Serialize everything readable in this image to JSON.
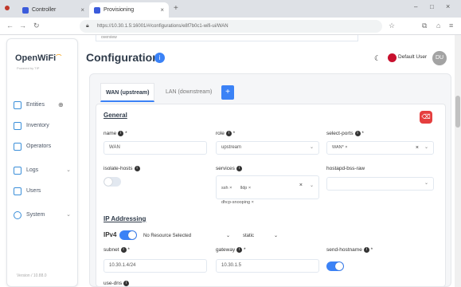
{
  "browser": {
    "tabs": [
      {
        "label": "Controller"
      },
      {
        "label": "Provisioning"
      }
    ],
    "url": "https://10.30.1.5:16001/#/configurations/e8f7b0c1-wifi-ui/WAN",
    "partial_top_text": "overview"
  },
  "sidebar": {
    "logo": "OpenWiFi",
    "logo_sub": "Powered by TIP",
    "items": [
      {
        "label": "Entities",
        "icon": "entities-icon",
        "has_chevron": false
      },
      {
        "label": "Inventory",
        "icon": "inventory-icon",
        "has_chevron": false
      },
      {
        "label": "Operators",
        "icon": "operators-icon",
        "has_chevron": false
      },
      {
        "label": "Logs",
        "icon": "logs-icon",
        "has_chevron": true
      },
      {
        "label": "Users",
        "icon": "users-icon",
        "has_chevron": false
      },
      {
        "label": "System",
        "icon": "system-icon",
        "has_chevron": true
      }
    ],
    "version": "Version / 10.88.0"
  },
  "header": {
    "title": "Configuration",
    "user_name": "Default User",
    "avatar_initials": "DU"
  },
  "tabs": {
    "wan": "WAN (upstream)",
    "lan": "LAN (downstream)",
    "add": "+"
  },
  "general": {
    "heading": "General",
    "name_label": "name",
    "name_value": "WAN",
    "role_label": "role",
    "role_value": "upstream",
    "select_ports_label": "select-ports",
    "select_ports_value": "WAN* ×",
    "isolate_hosts_label": "isolate-hosts",
    "services_label": "services",
    "services_chips": [
      "ssh ×",
      "lldp ×",
      "dhcp-snooping ×"
    ],
    "hostapd_label": "hostapd-bss-raw"
  },
  "ip": {
    "heading": "IP Addressing",
    "ipv4_label": "IPv4",
    "resource_value": "No Resource Selected",
    "mode_value": "static",
    "subnet_label": "subnet",
    "subnet_value": "10.30.1.4/24",
    "gateway_label": "gateway",
    "gateway_value": "10.30.1.5",
    "send_hostname_label": "send-hostname",
    "next_label": "use-dns"
  },
  "colors": {
    "accent": "#3b82f6",
    "danger": "#e53e3e"
  }
}
